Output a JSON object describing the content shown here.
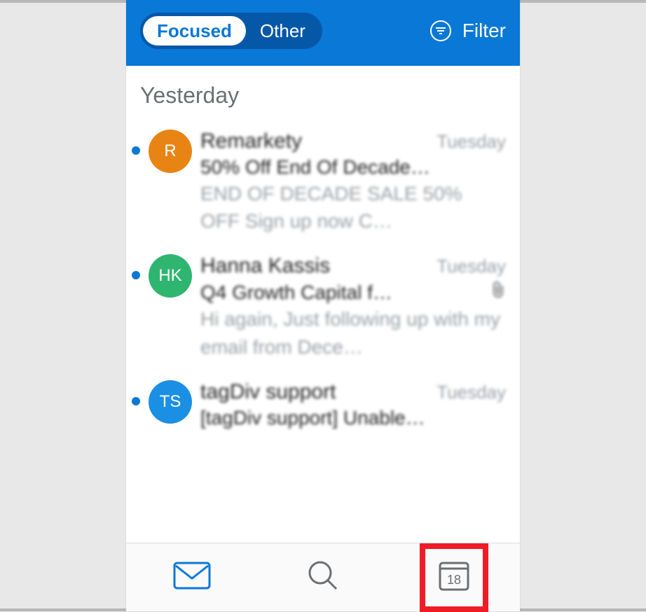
{
  "header": {
    "tabs": {
      "focused": "Focused",
      "other": "Other",
      "active": "focused"
    },
    "filter_label": "Filter"
  },
  "section": {
    "label": "Yesterday"
  },
  "messages": [
    {
      "unread": true,
      "avatar": {
        "initials": "R",
        "bg": "#e88413"
      },
      "sender": "Remarkety",
      "time": "Tuesday",
      "subject": "50% Off End Of Decade…",
      "preview": "END OF DECADE SALE 50% OFF Sign up now C…",
      "has_attachment": false
    },
    {
      "unread": true,
      "avatar": {
        "initials": "HK",
        "bg": "#2eb56f"
      },
      "sender": "Hanna Kassis",
      "time": "Tuesday",
      "subject": "Q4 Growth Capital f…",
      "preview": "Hi again, Just following up with my email from Dece…",
      "has_attachment": true
    },
    {
      "unread": true,
      "avatar": {
        "initials": "TS",
        "bg": "#1a8fe3"
      },
      "sender": "tagDiv support",
      "time": "Tuesday",
      "subject": "[tagDiv support] Unable…",
      "preview": "",
      "has_attachment": false
    }
  ],
  "nav": {
    "calendar_day": "18",
    "active": "mail"
  },
  "annotation": {
    "highlight_target": "calendar-tab"
  }
}
